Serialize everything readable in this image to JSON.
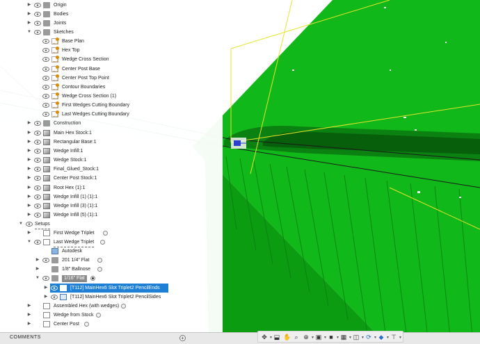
{
  "browser": {
    "items": [
      {
        "label": "Origin",
        "icon": "folder-icon",
        "indent": 1,
        "arrow": "▶",
        "eye": true
      },
      {
        "label": "Bodies",
        "icon": "folder-icon",
        "indent": 1,
        "arrow": "▶",
        "eye": true
      },
      {
        "label": "Joints",
        "icon": "folder-icon",
        "indent": 1,
        "arrow": "▶",
        "eye": true
      },
      {
        "label": "Sketches",
        "icon": "folder-icon",
        "indent": 1,
        "arrow": "▼",
        "eye": true
      },
      {
        "label": "Base Plan",
        "icon": "sketch-icon",
        "indent": 2,
        "eye": true
      },
      {
        "label": "Hex Top",
        "icon": "sketch-icon",
        "indent": 2,
        "eye": true
      },
      {
        "label": "Wedge Cross Section",
        "icon": "sketch-icon",
        "indent": 2,
        "eye": true
      },
      {
        "label": "Center Post Base",
        "icon": "sketch-icon",
        "indent": 2,
        "eye": true
      },
      {
        "label": "Center Post Top Point",
        "icon": "sketch-icon",
        "indent": 2,
        "eye": true
      },
      {
        "label": "Contour Boundaries",
        "icon": "sketch-icon",
        "indent": 2,
        "eye": true
      },
      {
        "label": "Wedge Cross Section (1)",
        "icon": "sketch-icon",
        "indent": 2,
        "eye": true
      },
      {
        "label": "First Wedges Cutting Boundary",
        "icon": "sketch-icon",
        "indent": 2,
        "eye": true
      },
      {
        "label": "Last Wedges Cutting Boundary",
        "icon": "sketch-icon",
        "indent": 2,
        "eye": true
      },
      {
        "label": "Construction",
        "icon": "folder-icon",
        "indent": 1,
        "arrow": "▶",
        "eye": true
      },
      {
        "label": "Main Hex Stock:1",
        "icon": "body-icon",
        "indent": 1,
        "arrow": "▶",
        "eye": true
      },
      {
        "label": "Rectangular Base:1",
        "icon": "body-icon",
        "indent": 1,
        "arrow": "▶",
        "eye": true
      },
      {
        "label": "Wedge Infill:1",
        "icon": "body-icon",
        "indent": 1,
        "arrow": "▶",
        "eye": true
      },
      {
        "label": "Wedge Stock:1",
        "icon": "body-icon",
        "indent": 1,
        "arrow": "▶",
        "eye": true
      },
      {
        "label": "Final_Glued_Stock:1",
        "icon": "body-icon",
        "indent": 1,
        "arrow": "▶",
        "eye": true
      },
      {
        "label": "Center Post Stock:1",
        "icon": "body-icon",
        "indent": 1,
        "arrow": "▶",
        "eye": true
      },
      {
        "label": "Root Hex (1):1",
        "icon": "body-icon",
        "indent": 1,
        "arrow": "▶",
        "eye": true
      },
      {
        "label": "Wedge Infill (1) (1):1",
        "icon": "body-icon",
        "indent": 1,
        "arrow": "▶",
        "eye": true
      },
      {
        "label": "Wedge Infill (3) (1):1",
        "icon": "body-icon",
        "indent": 1,
        "arrow": "▶",
        "eye": true
      },
      {
        "label": "Wedge Infill (5) (1):1",
        "icon": "body-icon",
        "indent": 1,
        "arrow": "▶",
        "eye": true
      }
    ],
    "cam_items": [
      {
        "label": "Setups",
        "icon": "none",
        "indent": 0,
        "arrow": "▼",
        "eye": true
      },
      {
        "label": "First Wedge Triplet",
        "icon": "setup-icon",
        "indent": 1,
        "arrow": "▶",
        "eye": false,
        "radio": true
      },
      {
        "label": "Last Wedge Triplet",
        "icon": "setup-icon",
        "indent": 1,
        "arrow": "▼",
        "eye": true,
        "radio": true
      },
      {
        "label": "Autodesk",
        "icon": "stock-icon",
        "indent": 2,
        "eye": false
      },
      {
        "label": "201 1/4\" Flat",
        "icon": "folder-icon",
        "indent": 2,
        "arrow": "▶",
        "eye": true,
        "radio": true
      },
      {
        "label": "1/8\" Ballnose",
        "icon": "folder-icon",
        "indent": 2,
        "arrow": "▶",
        "eye": false,
        "radio": true
      },
      {
        "label": "1/16\" Flat",
        "icon": "folder-icon",
        "indent": 2,
        "arrow": "▼",
        "eye": true,
        "radio": true,
        "radioOn": true,
        "boxed": true
      },
      {
        "label": "[T112] MainHex6 Slot Triplet2 PencilEnds",
        "icon": "toolpath-icon",
        "indent": 3,
        "arrow": "▶",
        "eye": true,
        "selected": true
      },
      {
        "label": "[T112] MainHex6 Slot Triplet2 PencilSides",
        "icon": "toolpath-icon",
        "indent": 3,
        "arrow": "▶",
        "eye": true
      },
      {
        "label": "Assembled Hex (with wedges)",
        "icon": "setup-icon",
        "indent": 1,
        "arrow": "▶",
        "eye": false,
        "radio": true
      },
      {
        "label": "Wedge from Stock",
        "icon": "setup-icon",
        "indent": 1,
        "arrow": "▶",
        "eye": false,
        "radio": true
      },
      {
        "label": "Center Post",
        "icon": "setup-icon",
        "indent": 1,
        "arrow": "▶",
        "eye": false,
        "radio": true
      }
    ]
  },
  "comments": {
    "label": "COMMENTS"
  },
  "navbar": {
    "tools": [
      "orbit-icon",
      "look-at-icon",
      "pan-icon",
      "zoom-icon",
      "fit-icon",
      "display-style-icon",
      "visual-style-icon",
      "grid-icon",
      "viewports-icon",
      "environment-icon",
      "effects-icon",
      "measure-icon"
    ]
  },
  "colors": {
    "model_green": "#0fbf16",
    "selection_blue": "#1d7fd6",
    "sketch_yellow": "#e5e52a"
  }
}
